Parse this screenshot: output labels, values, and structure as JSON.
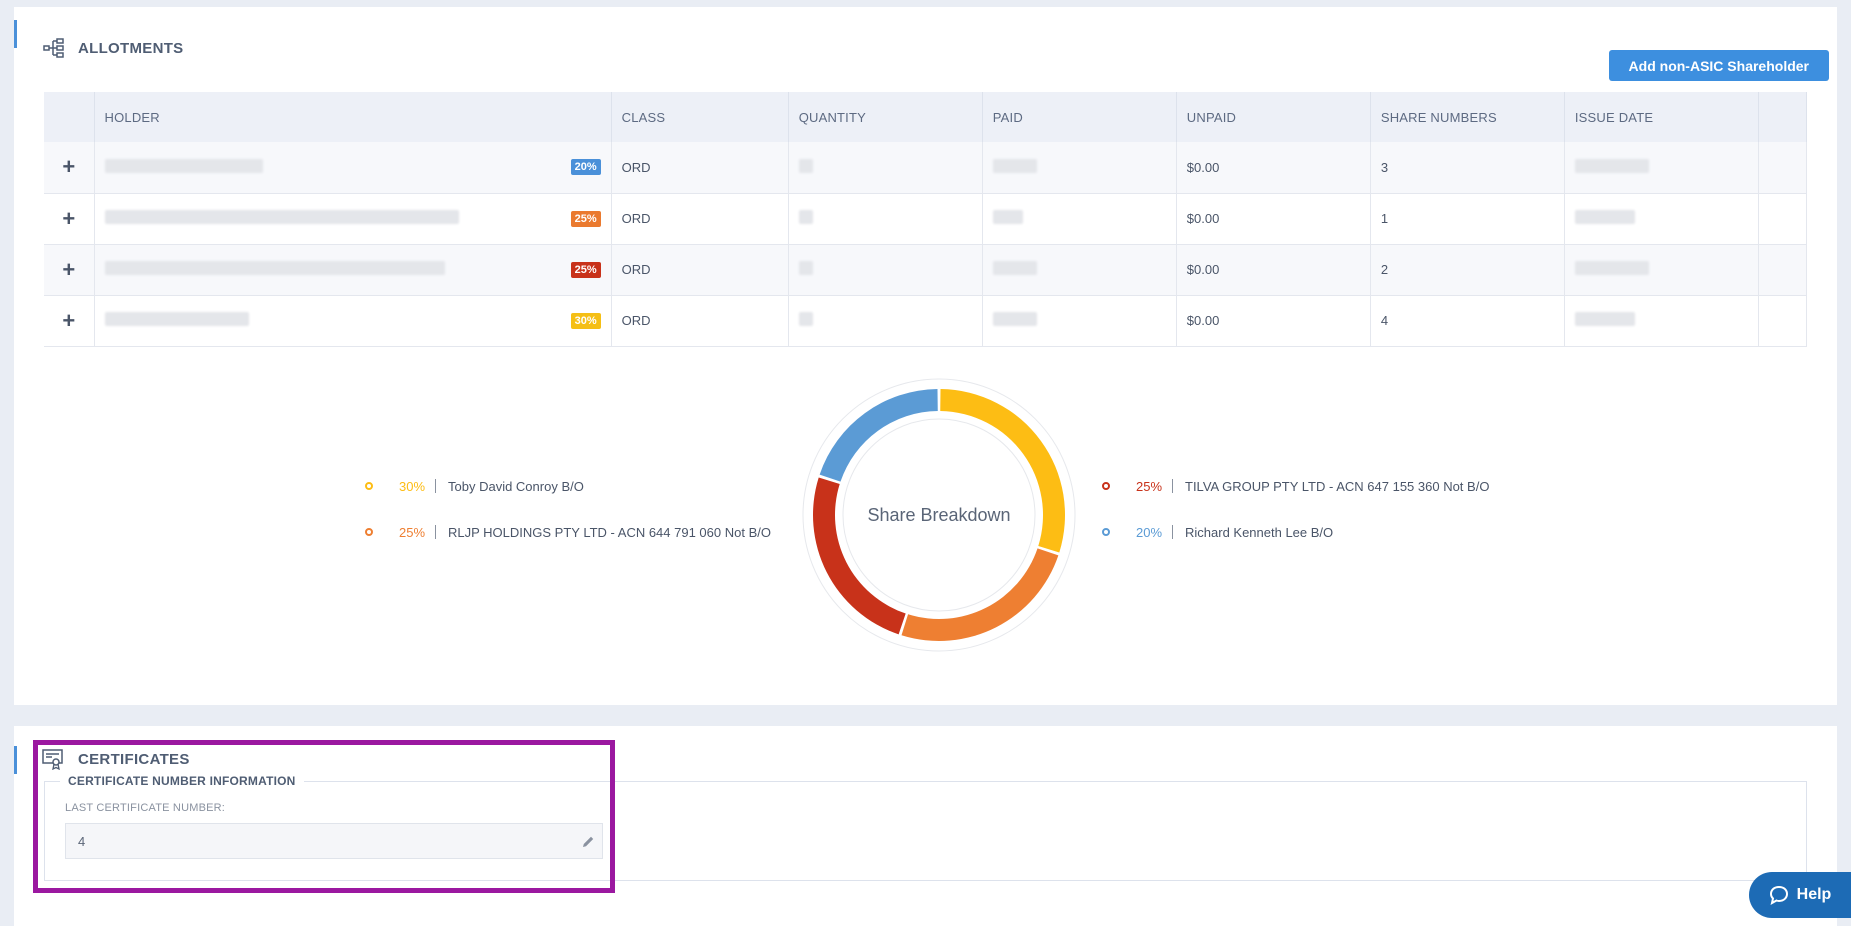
{
  "allotments": {
    "title": "ALLOTMENTS",
    "add_button_label": "Add non-ASIC Shareholder",
    "columns": [
      "HOLDER",
      "CLASS",
      "QUANTITY",
      "PAID",
      "UNPAID",
      "SHARE NUMBERS",
      "ISSUE DATE"
    ],
    "rows": [
      {
        "badge": "20%",
        "badge_color": "#4a90d9",
        "class": "ORD",
        "unpaid": "$0.00",
        "share_numbers": "3"
      },
      {
        "badge": "25%",
        "badge_color": "#ea7a2f",
        "class": "ORD",
        "unpaid": "$0.00",
        "share_numbers": "1"
      },
      {
        "badge": "25%",
        "badge_color": "#c8321a",
        "class": "ORD",
        "unpaid": "$0.00",
        "share_numbers": "2"
      },
      {
        "badge": "30%",
        "badge_color": "#f5bf15",
        "class": "ORD",
        "unpaid": "$0.00",
        "share_numbers": "4"
      }
    ]
  },
  "chart_data": {
    "type": "pie",
    "title": "Share Breakdown",
    "slices": [
      {
        "name": "Toby David Conroy B/O",
        "value": 30,
        "label": "30%",
        "color": "#fdbd14"
      },
      {
        "name": "RLJP HOLDINGS PTY LTD - ACN 644 791 060 Not B/O",
        "value": 25,
        "label": "25%",
        "color": "#ee7f32"
      },
      {
        "name": "TILVA GROUP PTY LTD - ACN 647 155 360 Not B/O",
        "value": 25,
        "label": "25%",
        "color": "#c8321a"
      },
      {
        "name": "Richard Kenneth Lee B/O",
        "value": 20,
        "label": "20%",
        "color": "#5b9bd5"
      }
    ]
  },
  "certificates": {
    "title": "CERTIFICATES",
    "fieldset_title": "CERTIFICATE NUMBER INFORMATION",
    "last_number_label": "LAST CERTIFICATE NUMBER:",
    "last_number_value": "4"
  },
  "help": {
    "label": "Help"
  },
  "icons": {
    "allotments": "hierarchy-icon",
    "certificates": "certificate-icon",
    "edit": "pencil-icon",
    "help": "chat-bubble-icon",
    "expand": "plus-icon"
  }
}
